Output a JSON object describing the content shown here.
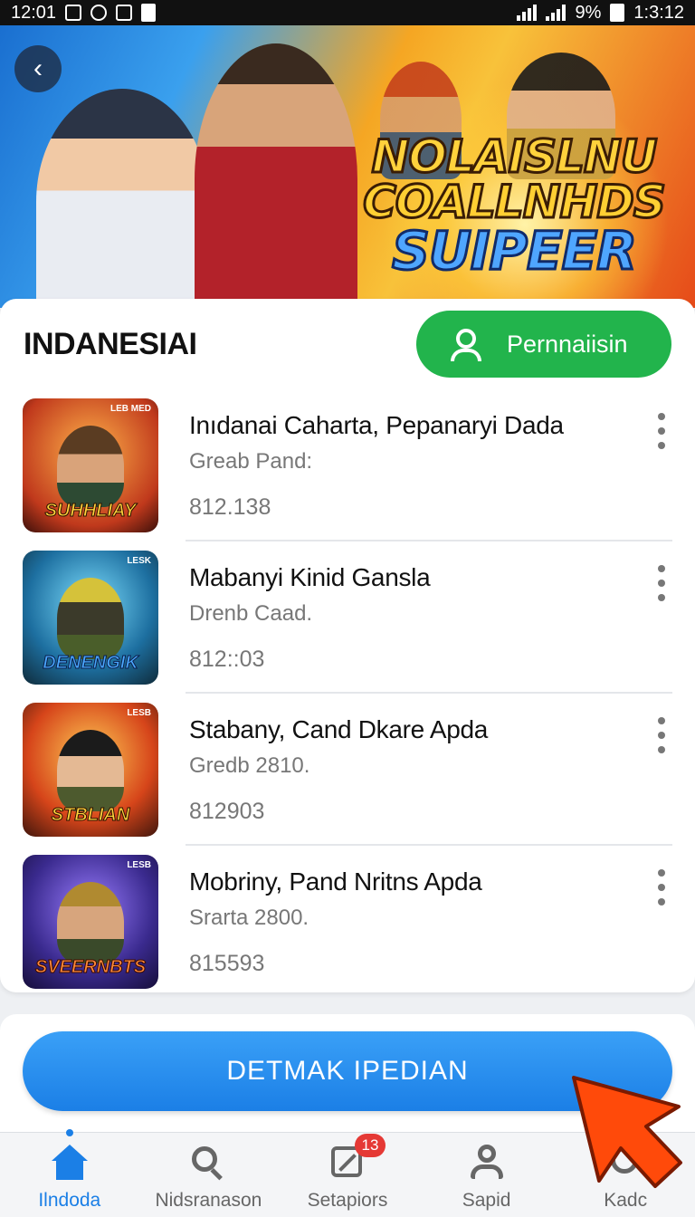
{
  "status_bar": {
    "time_left": "12:01",
    "battery": "9%",
    "time_right": "1:3:12"
  },
  "banner": {
    "title_lines": [
      "NOLAISLNU",
      "COALLNHDS",
      "SUIPEER"
    ]
  },
  "header": {
    "title": "INDANESIAI",
    "action_label": "Pernnaiisin"
  },
  "items": [
    {
      "title": "Inıdanai Caharta, Pepanaryi Dada",
      "subtitle": "Greab Pand:",
      "price": "812.138",
      "thumb_text": "SUHHLIAY",
      "thumb_tag": "LEB MED"
    },
    {
      "title": "Mabanyi Kinid Gansla",
      "subtitle": "Drenb Caad.",
      "price": "812::03",
      "thumb_text": "DENENGIK",
      "thumb_tag": "LESK"
    },
    {
      "title": "Stabany, Cand Dkare Apda",
      "subtitle": "Gredb 2810.",
      "price": "812903",
      "thumb_text": "STBLIAN",
      "thumb_tag": "LESB"
    },
    {
      "title": "Mobriny, Pand Nritns Apda",
      "subtitle": "Srarta 2800.",
      "price": "815593",
      "thumb_text": "SVEERNBTS",
      "thumb_tag": "LESB"
    }
  ],
  "cta": {
    "label": "DETMAK IPEDIAN"
  },
  "nav": {
    "items": [
      {
        "label": "Ilndoda",
        "icon": "home-icon"
      },
      {
        "label": "Nidsranason",
        "icon": "search-icon"
      },
      {
        "label": "Setapiors",
        "icon": "apps-icon",
        "badge": "13"
      },
      {
        "label": "Sapid",
        "icon": "user-icon"
      },
      {
        "label": "Kadc",
        "icon": "tag-icon"
      }
    ]
  },
  "colors": {
    "primary_blue": "#1b7fe6",
    "action_green": "#22b44c",
    "badge_red": "#e53935",
    "pointer_orange": "#ff4a0a"
  }
}
